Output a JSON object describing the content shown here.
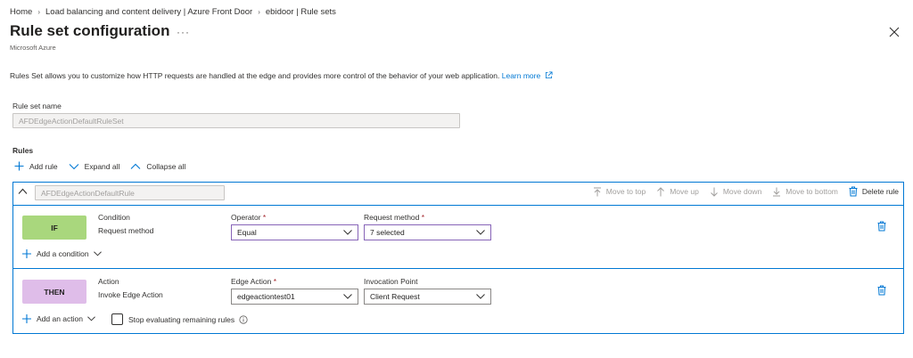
{
  "breadcrumb": [
    "Home",
    "Load balancing and content delivery | Azure Front Door",
    "ebidoor | Rule sets"
  ],
  "page": {
    "title": "Rule set configuration",
    "more_label": "···",
    "subtitle": "Microsoft Azure",
    "description": "Rules Set allows you to customize how HTTP requests are handled at the edge and provides more control of the behavior of your web application.",
    "learn_more": "Learn more"
  },
  "ruleset": {
    "name_label": "Rule set name",
    "name_value": "AFDEdgeActionDefaultRuleSet"
  },
  "rules": {
    "section_label": "Rules",
    "toolbar": {
      "add_rule": "Add rule",
      "expand_all": "Expand all",
      "collapse_all": "Collapse all"
    },
    "rule": {
      "name_value": "AFDEdgeActionDefaultRule",
      "actions": {
        "move_to_top": "Move to top",
        "move_up": "Move up",
        "move_down": "Move down",
        "move_to_bottom": "Move to bottom",
        "delete_rule": "Delete rule"
      },
      "condition": {
        "badge": "IF",
        "heading": "Condition",
        "type": "Request method",
        "operator_label": "Operator",
        "operator_value": "Equal",
        "method_label": "Request method",
        "method_value": "7 selected",
        "add_condition": "Add a condition"
      },
      "action": {
        "badge": "THEN",
        "heading": "Action",
        "type": "Invoke Edge Action",
        "edge_action_label": "Edge Action",
        "edge_action_value": "edgeactiontest01",
        "invocation_label": "Invocation Point",
        "invocation_value": "Client Request",
        "add_action": "Add an action",
        "stop_evaluating": "Stop evaluating remaining rules"
      }
    }
  },
  "colors": {
    "accent": "#0078d4",
    "if_badge": "#a9d77d",
    "then_badge": "#dfbde9",
    "focus_border": "#8764b8",
    "required": "#a4262c"
  }
}
